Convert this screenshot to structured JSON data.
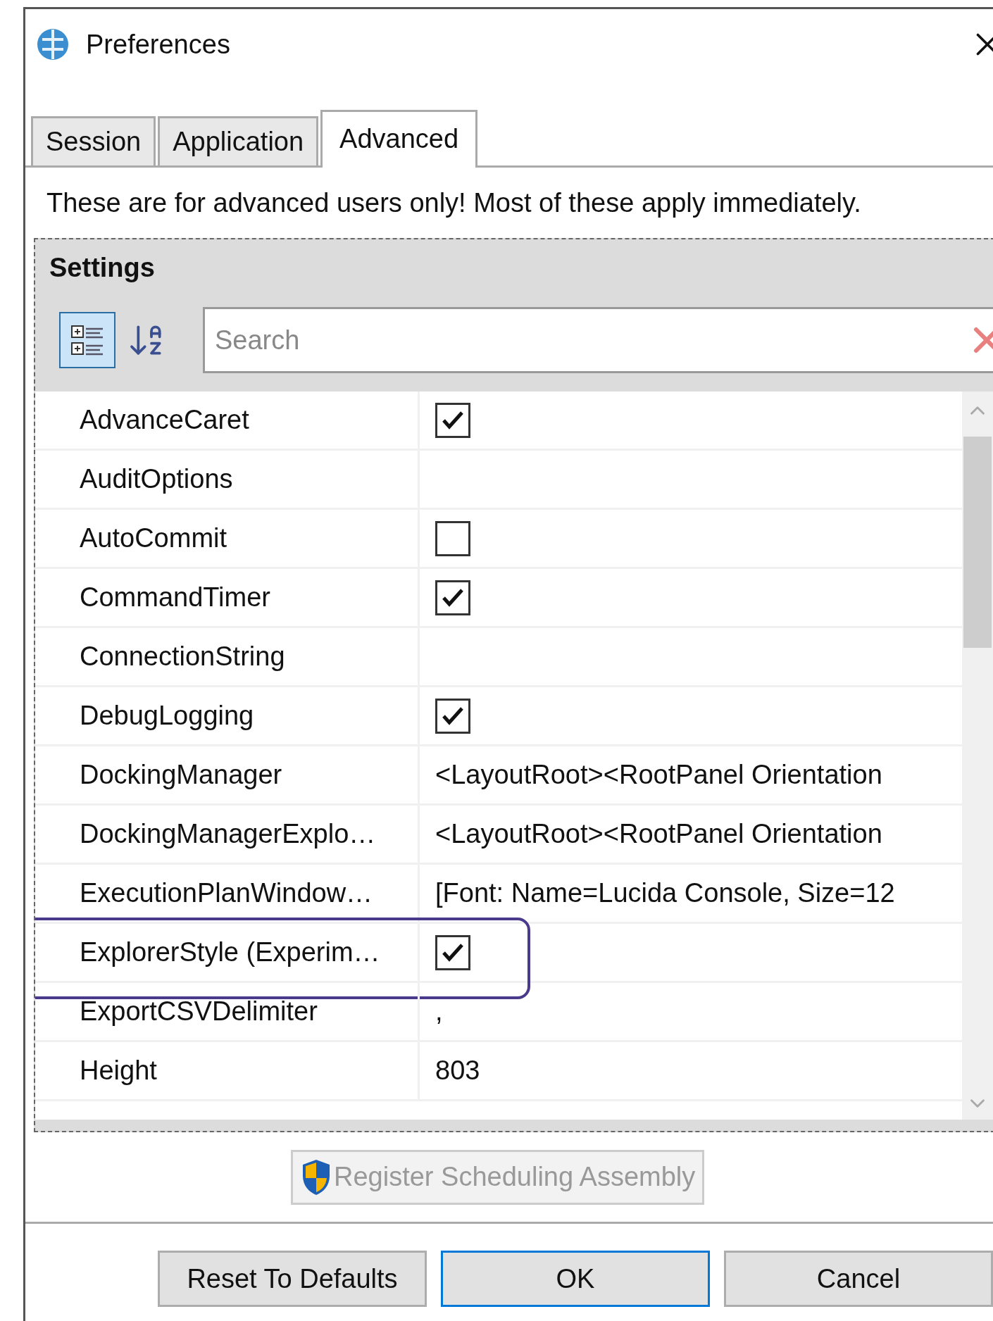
{
  "window": {
    "title": "Preferences"
  },
  "tabs": [
    {
      "label": "Session",
      "selected": false
    },
    {
      "label": "Application",
      "selected": false
    },
    {
      "label": "Advanced",
      "selected": true
    }
  ],
  "description": "These are for advanced users only! Most of these apply immediately.",
  "settings": {
    "title": "Settings",
    "view_modes": [
      {
        "kind": "categorized",
        "selected": true
      },
      {
        "kind": "alphabetical",
        "selected": false
      }
    ],
    "search": {
      "placeholder": "Search"
    },
    "rows": [
      {
        "name": "AdvanceCaret",
        "kind": "checkbox",
        "checked": true
      },
      {
        "name": "AuditOptions",
        "kind": "text"
      },
      {
        "name": "AutoCommit",
        "kind": "checkbox",
        "checked": false
      },
      {
        "name": "CommandTimer",
        "kind": "checkbox",
        "checked": true
      },
      {
        "name": "ConnectionString",
        "kind": "text"
      },
      {
        "name": "DebugLogging",
        "kind": "checkbox",
        "checked": true
      },
      {
        "name": "DockingManager",
        "kind": "text",
        "value": "<LayoutRoot><RootPanel Orientation"
      },
      {
        "name": "DockingManagerExplo…",
        "kind": "text",
        "value": "<LayoutRoot><RootPanel Orientation"
      },
      {
        "name": "ExecutionPlanWindow…",
        "kind": "text",
        "value": "[Font: Name=Lucida Console, Size=12"
      },
      {
        "name": "ExplorerStyle (Experim…",
        "kind": "checkbox",
        "checked": true,
        "highlighted": true
      },
      {
        "name": "ExportCSVDelimiter",
        "kind": "text",
        "value": ","
      },
      {
        "name": "Height",
        "kind": "text",
        "value": "803"
      }
    ]
  },
  "register_button": {
    "label": "Register Scheduling Assembly",
    "disabled": true
  },
  "buttons": [
    {
      "label": "Reset To Defaults",
      "default": false
    },
    {
      "label": "OK",
      "default": true
    },
    {
      "label": "Cancel",
      "default": false
    }
  ]
}
